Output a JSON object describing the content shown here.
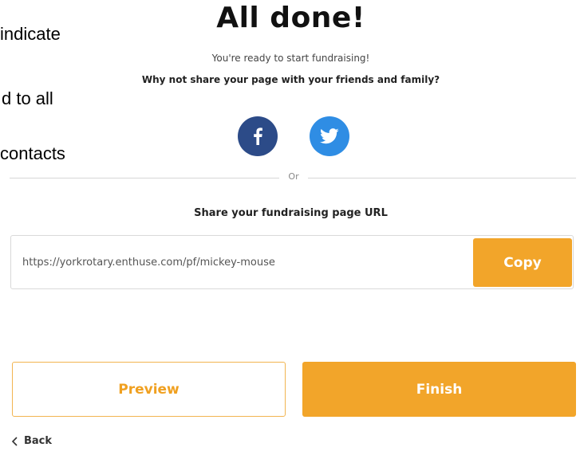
{
  "background_text": {
    "line1": "indicate",
    "line2": "d to all",
    "line3": "contacts"
  },
  "page": {
    "title": "All done!",
    "subtitle": "You're ready to start fundraising!",
    "share_prompt": "Why not share your page with your friends and family?"
  },
  "social": {
    "facebook_icon": "facebook-icon",
    "twitter_icon": "twitter-icon",
    "facebook_color": "#2c4b88",
    "twitter_color": "#2f8de4"
  },
  "divider": {
    "or_label": "Or"
  },
  "share_url": {
    "label": "Share your fundraising page URL",
    "value": "https://yorkrotary.enthuse.com/pf/mickey-mouse",
    "copy_label": "Copy"
  },
  "actions": {
    "preview_label": "Preview",
    "finish_label": "Finish",
    "back_label": "Back",
    "accent_color": "#f2a52a"
  }
}
